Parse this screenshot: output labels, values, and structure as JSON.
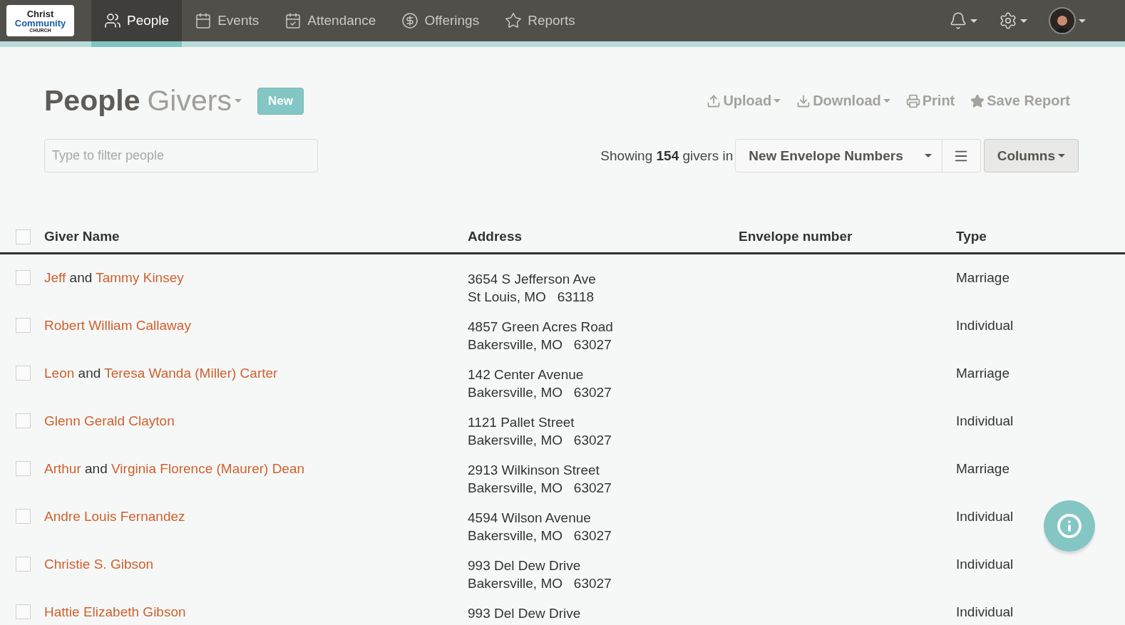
{
  "nav": {
    "logo": {
      "line1": "Christ",
      "line2": "Community",
      "line3": "CHURCH"
    },
    "tabs": [
      {
        "label": "People",
        "selected": true
      },
      {
        "label": "Events",
        "selected": false
      },
      {
        "label": "Attendance",
        "selected": false
      },
      {
        "label": "Offerings",
        "selected": false
      },
      {
        "label": "Reports",
        "selected": false
      }
    ]
  },
  "header": {
    "title": "People",
    "subtitle": "Givers",
    "badge": "New",
    "actions": [
      {
        "label": "Upload",
        "caret": true
      },
      {
        "label": "Download",
        "caret": true
      },
      {
        "label": "Print",
        "caret": false
      },
      {
        "label": "Save Report",
        "caret": false
      }
    ]
  },
  "filter": {
    "placeholder": "Type to filter people"
  },
  "summary": {
    "before": "Showing",
    "count": "154",
    "after": "givers in"
  },
  "report_select": {
    "value": "New Envelope Numbers"
  },
  "columns_button": "Columns",
  "table": {
    "all_checked": false,
    "columns": [
      "Giver Name",
      "Address",
      "Envelope number",
      "Type"
    ],
    "rows": [
      {
        "checked": false,
        "name": [
          {
            "kind": "link",
            "text": "Jeff"
          },
          {
            "kind": "plain",
            "text": "and"
          },
          {
            "kind": "link",
            "text": "Tammy Kinsey"
          }
        ],
        "address": [
          "3654 S Jefferson Ave",
          "St Louis, MO   63118"
        ],
        "type": "Marriage"
      },
      {
        "checked": false,
        "name": [
          {
            "kind": "link",
            "text": "Robert William Callaway"
          }
        ],
        "address": [
          "4857 Green Acres Road",
          "Bakersville, MO   63027"
        ],
        "type": "Individual"
      },
      {
        "checked": false,
        "name": [
          {
            "kind": "link",
            "text": "Leon"
          },
          {
            "kind": "plain",
            "text": "and"
          },
          {
            "kind": "link",
            "text": "Teresa Wanda (Miller) Carter"
          }
        ],
        "address": [
          "142 Center Avenue",
          "Bakersville, MO   63027"
        ],
        "type": "Marriage"
      },
      {
        "checked": false,
        "name": [
          {
            "kind": "link",
            "text": "Glenn Gerald Clayton"
          }
        ],
        "address": [
          "1121 Pallet Street",
          "Bakersville, MO   63027"
        ],
        "type": "Individual"
      },
      {
        "checked": false,
        "name": [
          {
            "kind": "link",
            "text": "Arthur"
          },
          {
            "kind": "plain",
            "text": "and"
          },
          {
            "kind": "link",
            "text": "Virginia Florence (Maurer) Dean"
          }
        ],
        "address": [
          "2913 Wilkinson Street",
          "Bakersville, MO   63027"
        ],
        "type": "Marriage"
      },
      {
        "checked": false,
        "name": [
          {
            "kind": "link",
            "text": "Andre Louis Fernandez"
          }
        ],
        "address": [
          "4594 Wilson Avenue",
          "Bakersville, MO   63027"
        ],
        "type": "Individual"
      },
      {
        "checked": false,
        "name": [
          {
            "kind": "link",
            "text": "Christie S. Gibson"
          }
        ],
        "address": [
          "993 Del Dew Drive",
          "Bakersville, MO   63027"
        ],
        "type": "Individual"
      },
      {
        "checked": false,
        "name": [
          {
            "kind": "link",
            "text": "Hattie Elizabeth Gibson"
          }
        ],
        "address": [
          "993 Del Dew Drive"
        ],
        "type": "Individual"
      }
    ]
  }
}
